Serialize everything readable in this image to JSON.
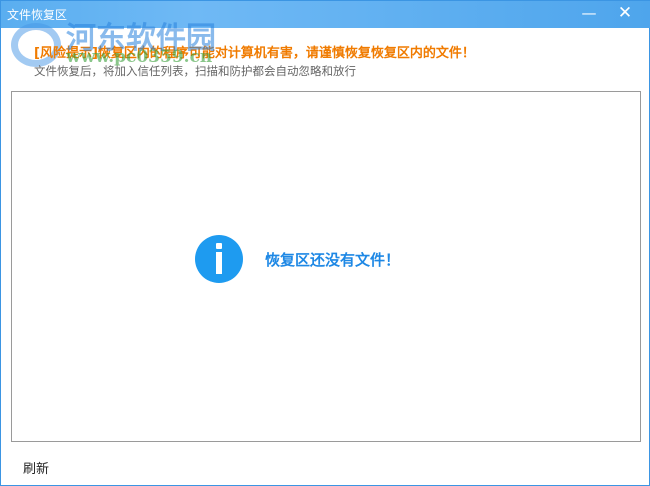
{
  "window": {
    "title": "文件恢复区",
    "minimize_label": "—",
    "close_label": "✕"
  },
  "warning": "[风险提示]恢复区内的程序可能对计算机有害，请谨慎恢复恢复区内的文件！",
  "subtitle": "文件恢复后，将加入信任列表，扫描和防护都会自动忽略和放行",
  "empty_state": {
    "icon": "info-icon",
    "message": "恢复区还没有文件！"
  },
  "footer": {
    "refresh_label": "刷新"
  },
  "watermark": {
    "name": "河东软件园",
    "url": "www.pc0359.cn"
  },
  "colors": {
    "titlebar": "#4ea5ec",
    "warning": "#f07b00",
    "accent": "#1e9bf0"
  }
}
